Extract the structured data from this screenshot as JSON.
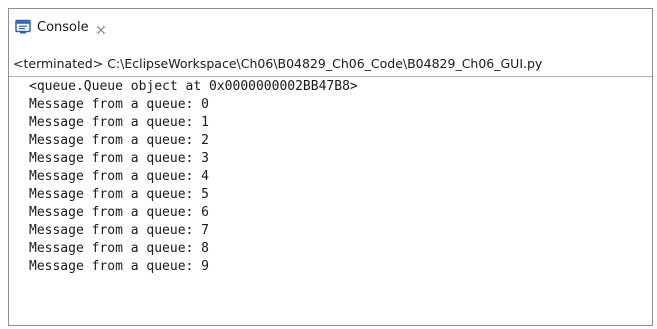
{
  "tab": {
    "label": "Console",
    "icon": "console-icon",
    "close_icon": "close-icon"
  },
  "process": {
    "label": "<terminated> C:\\EclipseWorkspace\\Ch06\\B04829_Ch06_Code\\B04829_Ch06_GUI.py"
  },
  "output": {
    "lines": [
      "<queue.Queue object at 0x0000000002BB47B8>",
      "Message from a queue: 0",
      "Message from a queue: 1",
      "Message from a queue: 2",
      "Message from a queue: 3",
      "Message from a queue: 4",
      "Message from a queue: 5",
      "Message from a queue: 6",
      "Message from a queue: 7",
      "Message from a queue: 8",
      "Message from a queue: 9"
    ]
  },
  "colors": {
    "icon_blue": "#2f5fb3",
    "text": "#1a1a1a",
    "border": "#8f8f8f"
  }
}
